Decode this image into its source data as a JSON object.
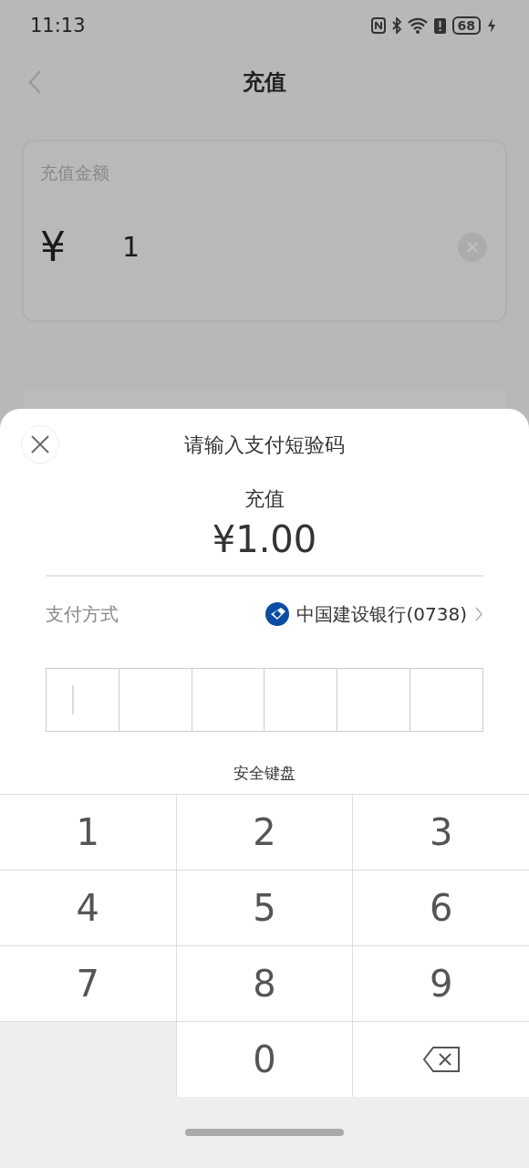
{
  "status_bar": {
    "time": "11:13",
    "battery": "68"
  },
  "header": {
    "title": "充值"
  },
  "amount_card": {
    "label": "充值金额",
    "currency": "¥",
    "value": "1"
  },
  "sheet": {
    "title": "请输入支付短验码",
    "purpose": "充值",
    "amount": "¥1.00",
    "payment_label": "支付方式",
    "payment_method": "中国建设银行(0738)",
    "code_cells": [
      {
        "focused": true
      },
      {
        "focused": false
      },
      {
        "focused": false
      },
      {
        "focused": false
      },
      {
        "focused": false
      },
      {
        "focused": false
      }
    ],
    "keyboard_title": "安全键盘",
    "keys": [
      {
        "kind": "digit",
        "label": "1"
      },
      {
        "kind": "digit",
        "label": "2"
      },
      {
        "kind": "digit",
        "label": "3"
      },
      {
        "kind": "digit",
        "label": "4"
      },
      {
        "kind": "digit",
        "label": "5"
      },
      {
        "kind": "digit",
        "label": "6"
      },
      {
        "kind": "digit",
        "label": "7"
      },
      {
        "kind": "digit",
        "label": "8"
      },
      {
        "kind": "digit",
        "label": "9"
      },
      {
        "kind": "blank"
      },
      {
        "kind": "digit",
        "label": "0"
      },
      {
        "kind": "backspace"
      }
    ]
  }
}
